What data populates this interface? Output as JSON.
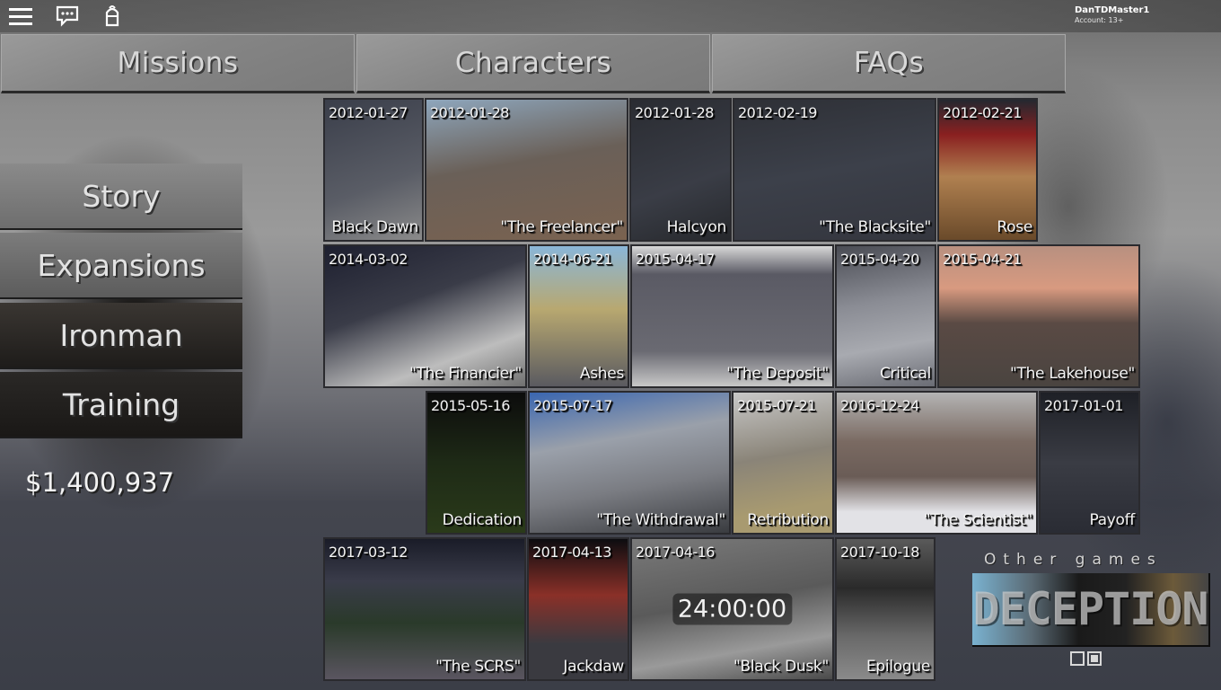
{
  "topbar": {
    "icons": [
      "menu-icon",
      "chat-icon",
      "backpack-icon"
    ],
    "username": "DanTDMaster1",
    "account": "Account: 13+"
  },
  "tabs": [
    {
      "label": "Missions"
    },
    {
      "label": "Characters"
    },
    {
      "label": "FAQs"
    }
  ],
  "sidebar": {
    "items": [
      {
        "label": "Story"
      },
      {
        "label": "Expansions"
      },
      {
        "label": "Ironman"
      },
      {
        "label": "Training"
      }
    ],
    "money": "$1,400,937"
  },
  "missions": [
    {
      "date": "2012-01-27",
      "title": "Black Dawn"
    },
    {
      "date": "2012-01-28",
      "title": "\"The Freelancer\""
    },
    {
      "date": "2012-01-28",
      "title": "Halcyon"
    },
    {
      "date": "2012-02-19",
      "title": "\"The Blacksite\""
    },
    {
      "date": "2012-02-21",
      "title": "Rose"
    },
    {
      "date": "2014-03-02",
      "title": "\"The Financier\""
    },
    {
      "date": "2014-06-21",
      "title": "Ashes"
    },
    {
      "date": "2015-04-17",
      "title": "\"The Deposit\""
    },
    {
      "date": "2015-04-20",
      "title": "Critical"
    },
    {
      "date": "2015-04-21",
      "title": "\"The Lakehouse\""
    },
    {
      "date": "2015-05-16",
      "title": "Dedication"
    },
    {
      "date": "2015-07-17",
      "title": "\"The Withdrawal\""
    },
    {
      "date": "2015-07-21",
      "title": "Retribution"
    },
    {
      "date": "2016-12-24",
      "title": "\"The Scientist\""
    },
    {
      "date": "2017-01-01",
      "title": "Payoff"
    },
    {
      "date": "2017-03-12",
      "title": "\"The SCRS\""
    },
    {
      "date": "2017-04-13",
      "title": "Jackdaw"
    },
    {
      "date": "2017-04-16",
      "title": "\"Black Dusk\"",
      "timer": "24:00:00"
    },
    {
      "date": "2017-10-18",
      "title": "Epilogue"
    }
  ],
  "other_games": {
    "label": "Other games",
    "banner_text": "DECEPTION",
    "pager": {
      "pages": 2,
      "active": 2
    }
  }
}
